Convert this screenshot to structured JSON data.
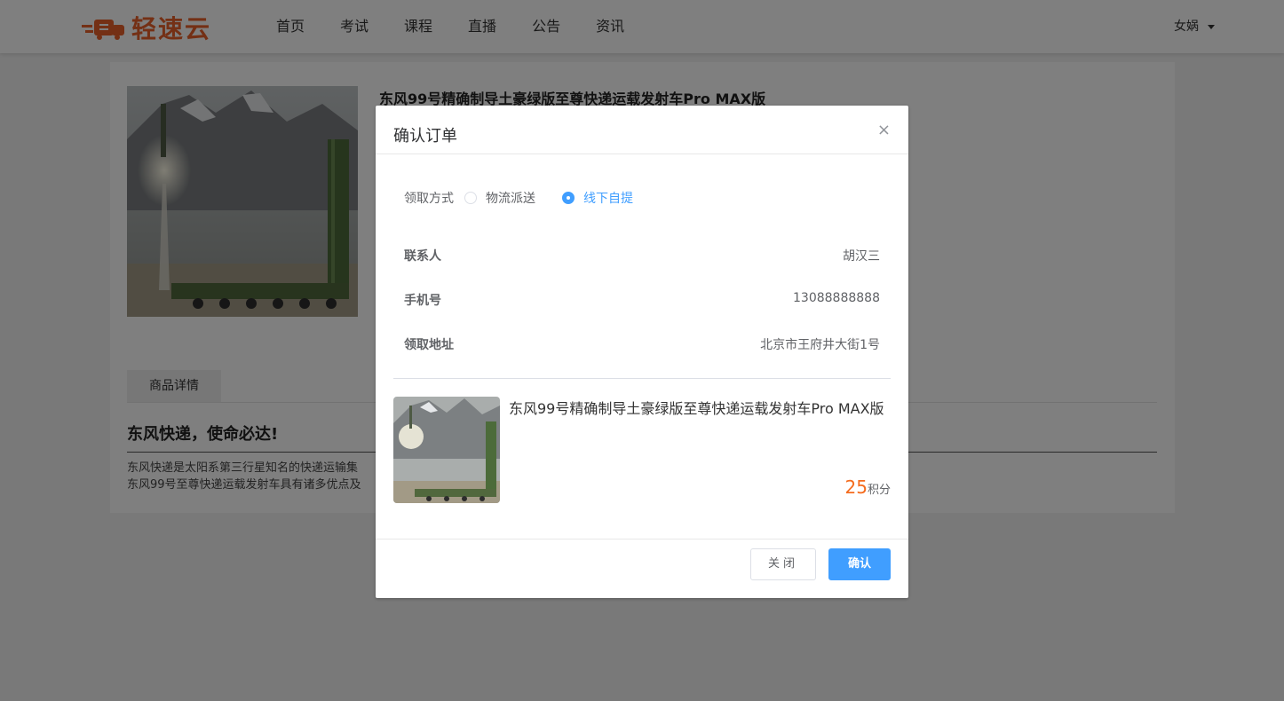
{
  "header": {
    "logo_text": "轻速云",
    "nav": [
      "首页",
      "考试",
      "课程",
      "直播",
      "公告",
      "资讯"
    ],
    "user_name": "女娲"
  },
  "product": {
    "title": "东风99号精确制导土豪绿版至尊快递运载发射车Pro MAX版",
    "tab_label": "商品详情",
    "detail_heading": "东风快递，使命必达!",
    "detail_lines": [
      "东风快递是太阳系第三行星知名的快递运输集",
      "东风99号至尊快递运载发射车具有诸多优点及"
    ]
  },
  "dialog": {
    "title": "确认订单",
    "close_icon": "×",
    "method_label": "领取方式",
    "methods": [
      {
        "label": "物流派送",
        "checked": false
      },
      {
        "label": "线下自提",
        "checked": true
      }
    ],
    "contact_label": "联系人",
    "contact_value": "胡汉三",
    "phone_label": "手机号",
    "phone_value": "13088888888",
    "address_label": "领取地址",
    "address_value": "北京市王府井大街1号",
    "item_title": "东风99号精确制导土豪绿版至尊快递运载发射车Pro MAX版",
    "item_price": "25",
    "item_price_unit": "积分",
    "cancel_label": "关闭",
    "confirm_label": "确认"
  },
  "colors": {
    "brand": "#e8612a",
    "primary": "#409eff",
    "price": "#f56c1e"
  }
}
